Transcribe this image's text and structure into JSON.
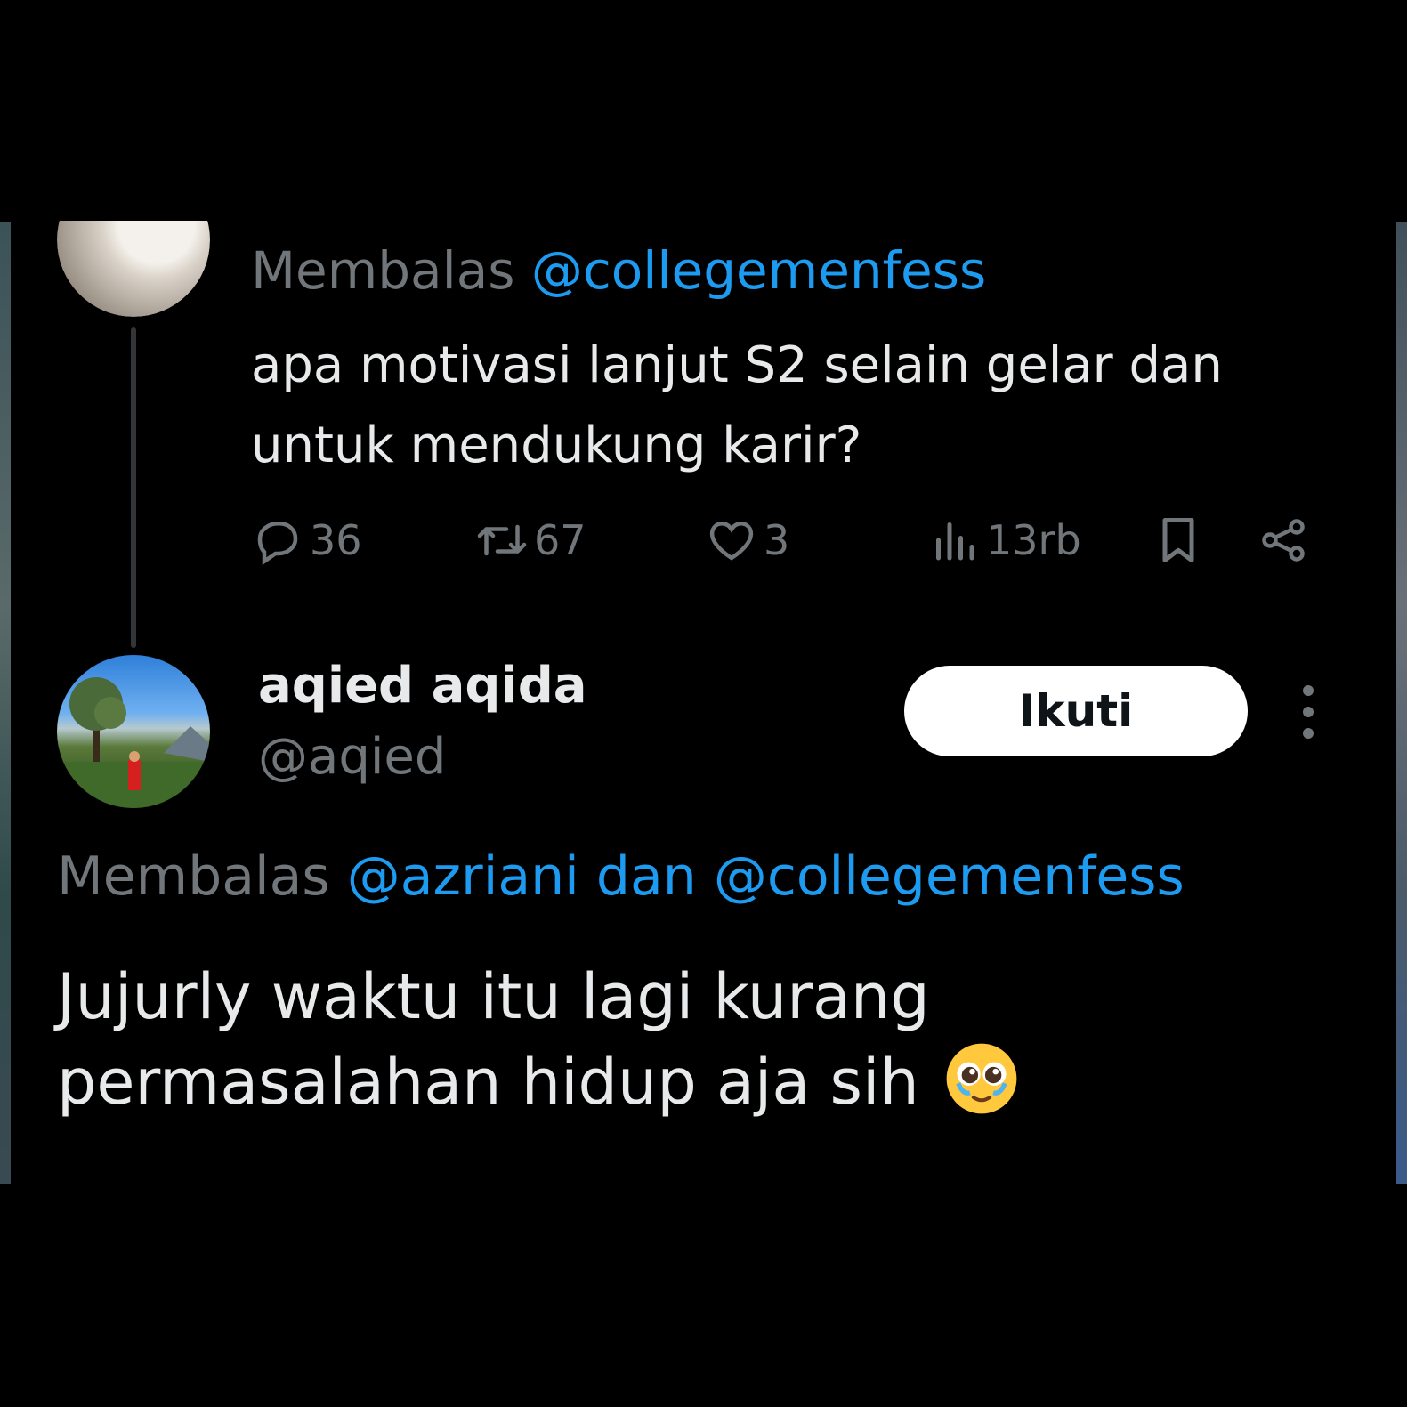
{
  "parent_tweet": {
    "replying_prefix": "Membalas",
    "replying_mentions": "@collegemenfess",
    "text": "apa motivasi lanjut S2 selain gelar dan untuk mendukung karir?",
    "stats": {
      "replies": "36",
      "retweets": "67",
      "likes": "3",
      "views": "13rb"
    }
  },
  "reply_tweet": {
    "display_name": "aqied aqida",
    "handle": "@aqied",
    "follow_label": "Ikuti",
    "replying_prefix": "Membalas",
    "replying_mentions": "@azriani dan @collegemenfess",
    "text": "Jujurly waktu itu lagi kurang permasalahan hidup aja sih",
    "emoji": "pleading-face-tears"
  },
  "colors": {
    "background": "#000000",
    "text": "#e7e9ea",
    "muted": "#71767b",
    "mention": "#1d9bf0",
    "button_bg": "#ffffff"
  }
}
